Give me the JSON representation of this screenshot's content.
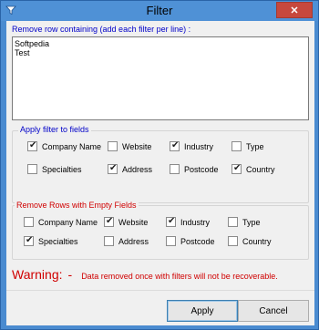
{
  "window": {
    "title": "Filter",
    "close_label": "✕",
    "accent": "#4f91d6"
  },
  "filter_text": {
    "label": "Remove row containing (add each filter per line) :",
    "lines": [
      "Softpedia",
      "Test"
    ]
  },
  "apply_fields": {
    "legend": "Apply filter to fields",
    "checkboxes": [
      {
        "label": "Company Name",
        "checked": true
      },
      {
        "label": "Website",
        "checked": false
      },
      {
        "label": "Industry",
        "checked": true
      },
      {
        "label": "Type",
        "checked": false
      },
      {
        "label": "Specialties",
        "checked": false
      },
      {
        "label": "Address",
        "checked": true
      },
      {
        "label": "Postcode",
        "checked": false
      },
      {
        "label": "Country",
        "checked": true
      }
    ]
  },
  "empty_fields": {
    "legend": "Remove Rows with Empty Fields",
    "checkboxes": [
      {
        "label": "Company Name",
        "checked": false
      },
      {
        "label": "Website",
        "checked": true
      },
      {
        "label": "Industry",
        "checked": true
      },
      {
        "label": "Type",
        "checked": false
      },
      {
        "label": "Specialties",
        "checked": true
      },
      {
        "label": "Address",
        "checked": false
      },
      {
        "label": "Postcode",
        "checked": false
      },
      {
        "label": "Country",
        "checked": false
      }
    ]
  },
  "warning": {
    "title": "Warning:",
    "dash": "-",
    "message": "Data removed once with filters will not be recoverable."
  },
  "buttons": {
    "apply": "Apply",
    "cancel": "Cancel"
  }
}
